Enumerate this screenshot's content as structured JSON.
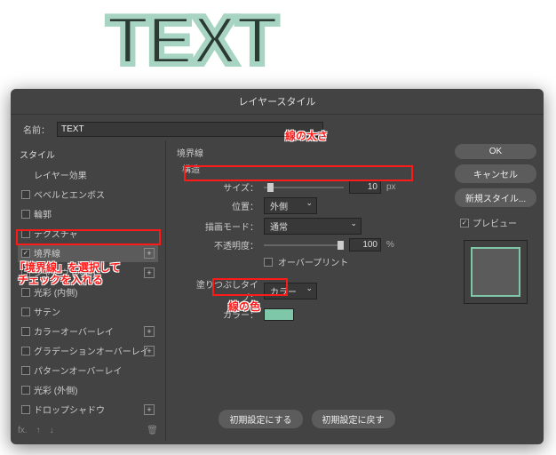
{
  "sample_text": "TEXT",
  "dialog_title": "レイヤースタイル",
  "name_label": "名前：",
  "name_value": "TEXT",
  "sidebar": {
    "heading": "スタイル",
    "items": [
      {
        "label": "レイヤー効果",
        "checked": null
      },
      {
        "label": "ベベルとエンボス",
        "checked": false
      },
      {
        "label": "輪郭",
        "checked": false
      },
      {
        "label": "テクスチャ",
        "checked": false
      },
      {
        "label": "境界線",
        "checked": true,
        "plus": true,
        "selected": true
      },
      {
        "label": "シャドウ (内側)",
        "checked": false,
        "plus": true
      },
      {
        "label": "光彩 (内側)",
        "checked": false
      },
      {
        "label": "サテン",
        "checked": false
      },
      {
        "label": "カラーオーバーレイ",
        "checked": false,
        "plus": true
      },
      {
        "label": "グラデーションオーバーレイ",
        "checked": false,
        "plus": true
      },
      {
        "label": "パターンオーバーレイ",
        "checked": false
      },
      {
        "label": "光彩 (外側)",
        "checked": false
      },
      {
        "label": "ドロップシャドウ",
        "checked": false,
        "plus": true
      }
    ]
  },
  "main": {
    "section": "境界線",
    "structure": "構造",
    "size_label": "サイズ：",
    "size_value": "10",
    "size_unit": "px",
    "position_label": "位置：",
    "position_value": "外側",
    "blend_label": "描画モード：",
    "blend_value": "通常",
    "opacity_label": "不透明度：",
    "opacity_value": "100",
    "opacity_unit": "%",
    "overprint_label": "オーバープリント",
    "filltype_label": "塗りつぶしタイプ：",
    "filltype_value": "カラー",
    "color_label": "カラー：",
    "color_value": "#7ec7a8",
    "default_btn": "初期設定にする",
    "reset_btn": "初期設定に戻す"
  },
  "right": {
    "ok": "OK",
    "cancel": "キャンセル",
    "new_style": "新規スタイル...",
    "preview_label": "プレビュー"
  },
  "annotations": {
    "thickness": "線の太さ",
    "select_stroke_1": "「境界線」を選択して",
    "select_stroke_2": "チェックを入れる",
    "color": "線の色"
  }
}
